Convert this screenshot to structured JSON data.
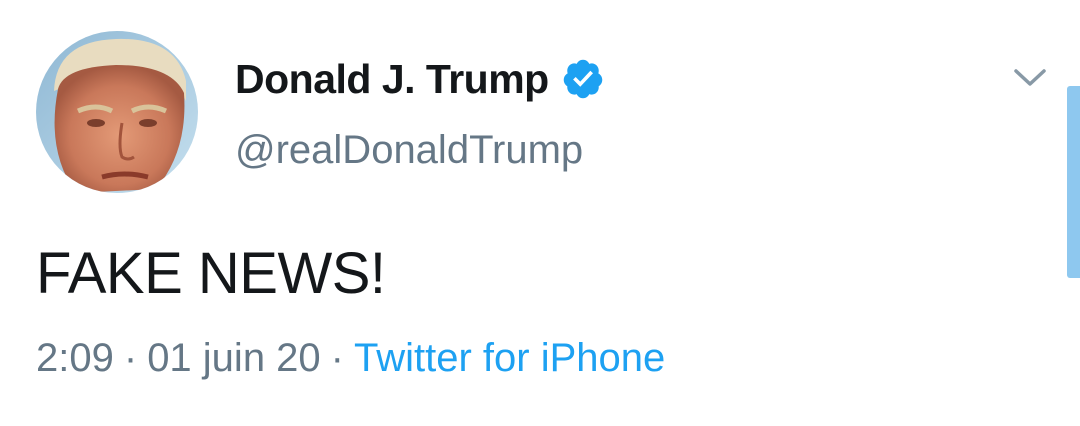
{
  "tweet": {
    "author": {
      "display_name": "Donald J. Trump",
      "handle": "@realDonaldTrump",
      "verified": true,
      "avatar_icon": "profile-photo"
    },
    "text": "FAKE NEWS!",
    "meta": {
      "time": "2:09",
      "date": "01 juin 20",
      "separator": "·",
      "source": "Twitter for iPhone"
    },
    "menu_icon": "chevron-down-icon"
  },
  "colors": {
    "text_primary": "#14171a",
    "text_secondary": "#657786",
    "accent_blue": "#1da1f2",
    "scrollbar": "#8ec8ef"
  }
}
